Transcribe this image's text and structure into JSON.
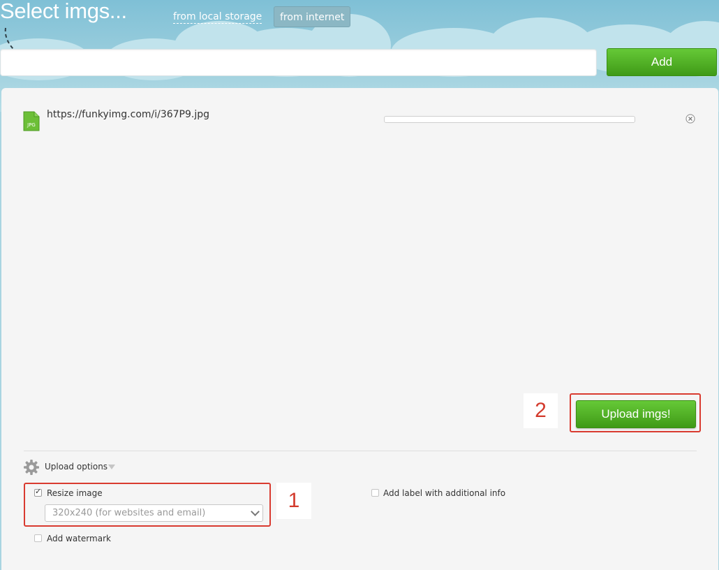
{
  "header": {
    "title": "Select imgs...",
    "tabs": [
      {
        "label": "from local storage",
        "active": false
      },
      {
        "label": "from internet",
        "active": true
      }
    ],
    "url_input": {
      "value": "",
      "placeholder": ""
    },
    "add_label": "Add"
  },
  "files": [
    {
      "type": "JPG",
      "url": "https://funkyimg.com/i/367P9.jpg",
      "progress": 0
    }
  ],
  "upload_label": "Upload imgs!",
  "annotations": {
    "first": "1",
    "second": "2"
  },
  "options": {
    "toggle_label": "Upload options",
    "resize": {
      "label": "Resize image",
      "checked": true,
      "selected": "320x240 (for websites and email)"
    },
    "add_label_info": {
      "label": "Add label with additional info",
      "checked": false
    },
    "watermark": {
      "label": "Add watermark",
      "checked": false
    }
  },
  "colors": {
    "accent_green": "#4caf1f",
    "annotation_red": "#d93b30",
    "sky": "#9fd0de"
  },
  "icons": [
    "dashed-arrow-icon",
    "jpg-file-icon",
    "remove-icon",
    "gear-icon",
    "caret-down-icon",
    "chevron-down-icon",
    "checkmark-icon"
  ]
}
